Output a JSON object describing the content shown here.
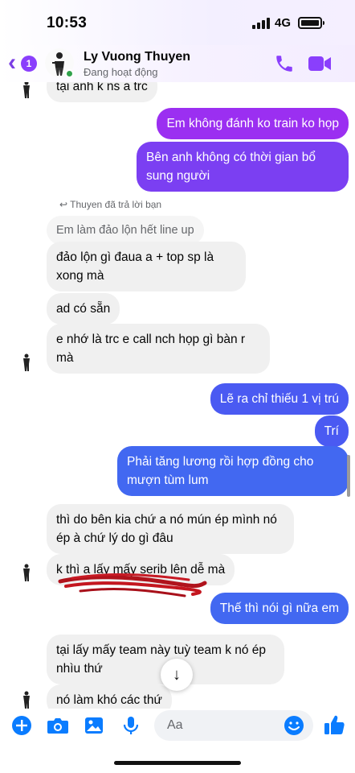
{
  "status_bar": {
    "time": "10:53",
    "network": "4G"
  },
  "header": {
    "back_badge": "1",
    "contact_name": "Ly Vuong Thuyen",
    "contact_status": "Đang hoạt động",
    "accent_color": "#8a3ffc",
    "icons": [
      "back-chevron-icon",
      "phone-icon",
      "video-camera-icon"
    ]
  },
  "messages": [
    {
      "id": "m0",
      "side": "in",
      "text": "tại anh k ns a trc"
    },
    {
      "id": "m1",
      "side": "out",
      "text": "Em không đánh ko train ko họp"
    },
    {
      "id": "m2",
      "side": "out",
      "text": "Bên anh không có thời gian bổ sung người"
    },
    {
      "id": "m3",
      "side": "meta",
      "text": "Thuyen đã trả lời bạn"
    },
    {
      "id": "m4",
      "side": "quote",
      "text": "Em làm đảo lộn hết line up"
    },
    {
      "id": "m5",
      "side": "in",
      "text": "đảo lộn gì đaua a + top sp là xong mà"
    },
    {
      "id": "m6",
      "side": "in",
      "text": "ad có sẵn"
    },
    {
      "id": "m7",
      "side": "in",
      "text": "e nhớ là trc e call nch họp gì bàn r mà"
    },
    {
      "id": "m8",
      "side": "out",
      "text": "Lẽ ra chỉ thiếu 1 vị trú"
    },
    {
      "id": "m9",
      "side": "out",
      "text": "Trí"
    },
    {
      "id": "m10",
      "side": "out",
      "text": "Phải tăng lương rồi hợp đồng cho mượn tùm lum"
    },
    {
      "id": "m11",
      "side": "in",
      "text": "thì do bên kia chứ a nó mún ép mình nó ép à chứ lý do gì đâu"
    },
    {
      "id": "m12",
      "side": "in",
      "text": "k thì a lấy mấy serib lên dễ mà"
    },
    {
      "id": "m13",
      "side": "out",
      "text": "Thế thì nói gì nữa em"
    },
    {
      "id": "m14",
      "side": "in",
      "text": "tại lấy mấy team này tuỳ team k nó ép nhìu thứ"
    },
    {
      "id": "m15",
      "side": "in",
      "text": "nó làm khó các thứ"
    }
  ],
  "composer": {
    "placeholder": "Aa",
    "icons": [
      "plus-icon",
      "camera-icon",
      "image-icon",
      "microphone-icon",
      "emoji-icon",
      "thumbs-up-icon"
    ]
  },
  "colors": {
    "outgoing_purple": "#9b2ff1",
    "outgoing_blue": "#4a5af2",
    "incoming_gray": "#f0f0f0",
    "icon_blue": "#0a7cff"
  }
}
